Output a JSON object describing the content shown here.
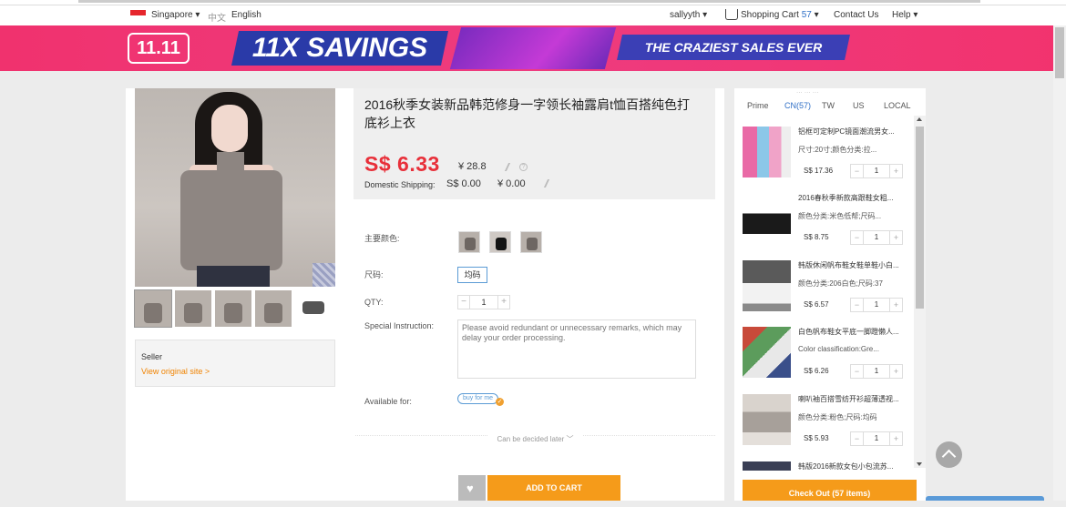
{
  "topnav": {
    "region": "Singapore",
    "lang_zh": "中文",
    "lang_en": "English",
    "user": "sallyyth",
    "cart_label": "Shopping Cart",
    "cart_count": "57",
    "contact": "Contact Us",
    "help": "Help"
  },
  "banner": {
    "badge": "11.11",
    "headline": "11X SAVINGS",
    "tagline": "THE CRAZIEST SALES EVER"
  },
  "product": {
    "title": "2016秋季女装新品韩范修身一字领长袖露肩t恤百搭纯色打底衫上衣",
    "price_sgd": "S$ 6.33",
    "price_cny": "¥  28.8",
    "shipping_label": "Domestic Shipping:",
    "shipping_sgd": "S$ 0.00",
    "shipping_cny": "¥  0.00",
    "help_glyph": "?",
    "color_label": "主要颜色:",
    "size_label": "尺码:",
    "size_value": "均码",
    "qty_label": "QTY:",
    "qty_value": "1",
    "qty_minus": "−",
    "qty_plus": "+",
    "instruction_label": "Special Instruction:",
    "instruction_placeholder": "Please avoid redundant or unnecessary remarks, which may delay your order processing.",
    "available_label": "Available for:",
    "buy_for_me": "buy for me",
    "check_glyph": "✓",
    "decide_later": "Can be decided later ﹀",
    "add_to_cart": "ADD TO CART",
    "heart_glyph": "♥"
  },
  "seller": {
    "label": "Seller",
    "link": "View original site >"
  },
  "cart_panel": {
    "faded_text": "...  ...  ...",
    "tabs": [
      "Prime",
      "CN(57)",
      "TW",
      "US",
      "LOCAL"
    ],
    "active_tab": "CN(57)",
    "items": [
      {
        "name": "铝框可定制PC镜面潮流男女...",
        "spec": "尺寸:20寸;颜色分类:拉...",
        "price": "S$ 17.36",
        "qty": "1"
      },
      {
        "name": "2016春秋季新款高跟鞋女粗...",
        "spec": "颜色分类:米色低帮;尺码...",
        "price": "S$ 8.75",
        "qty": "1"
      },
      {
        "name": "韩版休闲帆布鞋女鞋单鞋小白...",
        "spec": "颜色分类:206白色;尺码:37",
        "price": "S$ 6.57",
        "qty": "1"
      },
      {
        "name": "白色帆布鞋女平底一脚蹬懒人...",
        "spec": "Color classification:Gre...",
        "price": "S$ 6.26",
        "qty": "1"
      },
      {
        "name": "喇叭袖百搭雪纺开衫超薄透视...",
        "spec": "颜色分类:粉色;尺码:均码",
        "price": "S$ 5.93",
        "qty": "1"
      },
      {
        "name": "韩版2016新款女包小包流苏...",
        "spec": "",
        "price": "",
        "qty": ""
      }
    ],
    "checkout": "Check Out (57 items)"
  },
  "colors": {
    "accent_orange": "#f59b1a",
    "price_red": "#e8303a",
    "link_blue": "#2f6fc6",
    "banner_pink": "#ee3b7f"
  }
}
